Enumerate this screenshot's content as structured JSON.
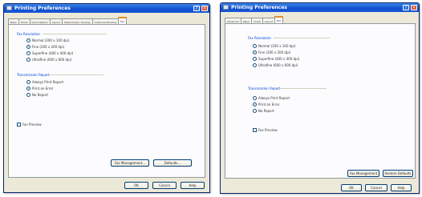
{
  "left_window": {
    "title": "Printing Preferences",
    "help_glyph": "?",
    "close_glyph": "×",
    "tabs": [
      "Basic",
      "Finish",
      "Input Options",
      "Layout",
      "Watermarks / Overlay",
      "Advanced Printing",
      "Fax"
    ],
    "active_tab": "Fax",
    "group1": {
      "caption": "Fax Resolution",
      "options": [
        "Normal (200 x 100 dpi)",
        "Fine (200 x 200 dpi)",
        "Superfine (400 x 400 dpi)",
        "Ultrafine (600 x 600 dpi)"
      ],
      "selected": 1
    },
    "group2": {
      "caption": "Transmission Report",
      "options": [
        "Always Print Report",
        "Print on Error",
        "No Report"
      ],
      "selected": 1
    },
    "checkbox_label": "Fax Preview",
    "buttons": {
      "fax_management": "Fax Management...",
      "defaults": "Defaults..."
    },
    "footer": {
      "ok": "OK",
      "cancel": "Cancel",
      "help": "Help"
    }
  },
  "right_window": {
    "title": "Printing Preferences",
    "help_glyph": "?",
    "close_glyph": "×",
    "tabs": [
      "Advanced",
      "Paper",
      "Finish",
      "Layout",
      "Fax"
    ],
    "active_tab": "Fax",
    "group1": {
      "caption": "Fax Resolution",
      "options": [
        "Normal (200 x 100 dpi)",
        "Fine (200 x 200 dpi)",
        "Superfine (400 x 400 dpi)",
        "Ultrafine (600 x 600 dpi)"
      ],
      "selected": 1
    },
    "group2": {
      "caption": "Transmission Report",
      "options": [
        "Always Print Report",
        "Print on Error",
        "No Report"
      ],
      "selected": 1
    },
    "checkbox_label": "Fax Preview",
    "buttons": {
      "fax_management": "Fax Management",
      "restore_defaults": "Restore Defaults"
    },
    "footer": {
      "ok": "OK",
      "cancel": "Cancel",
      "help": "Help"
    }
  }
}
